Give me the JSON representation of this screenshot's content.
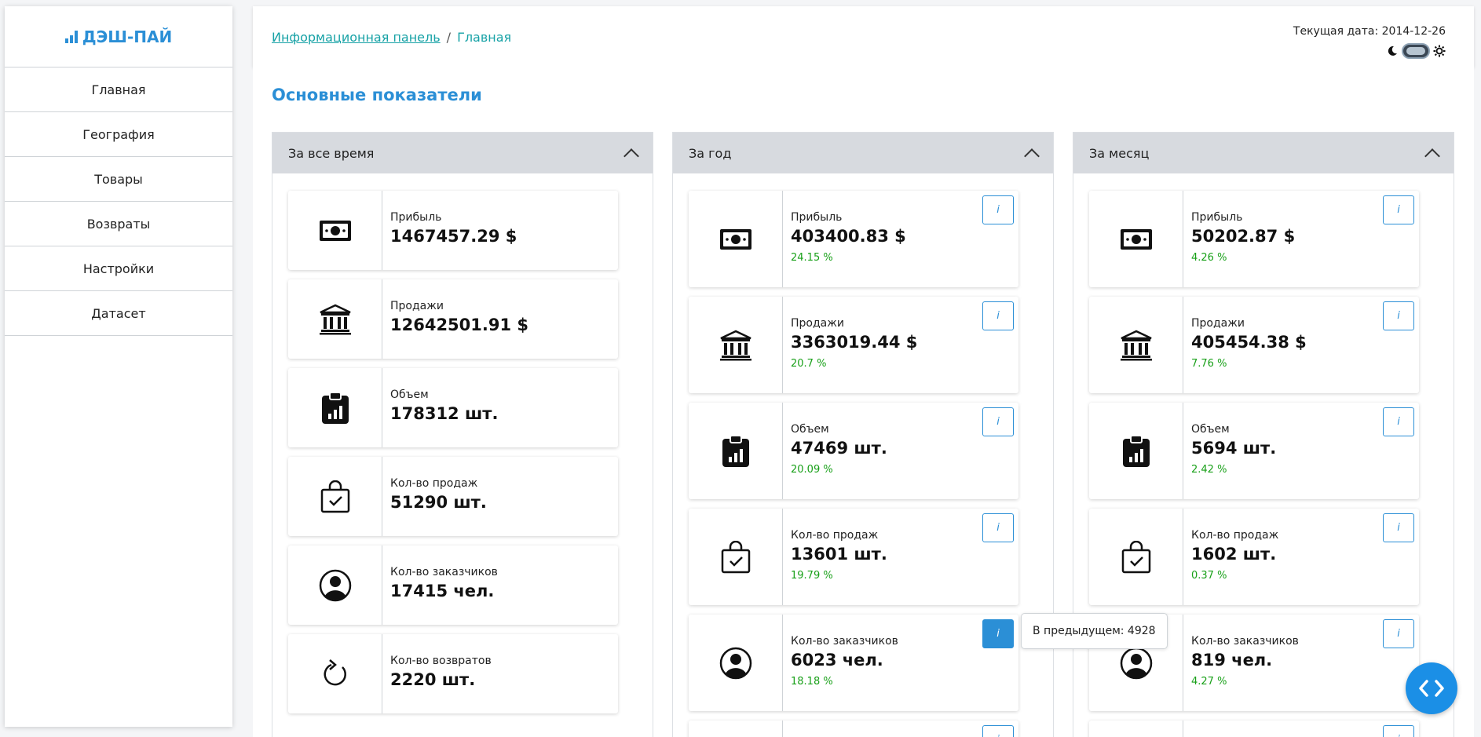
{
  "app": {
    "logo": "ДЭШ-ПАЙ"
  },
  "sidebar": {
    "items": [
      {
        "label": "Главная"
      },
      {
        "label": "География"
      },
      {
        "label": "Товары"
      },
      {
        "label": "Возвраты"
      },
      {
        "label": "Настройки"
      },
      {
        "label": "Датасет"
      }
    ]
  },
  "header": {
    "breadcrumb": {
      "link": "Информационная панель",
      "separator": "/",
      "current": "Главная"
    },
    "date": "Текущая дата: 2014-12-26"
  },
  "main": {
    "title": "Основные показатели"
  },
  "columns": [
    {
      "title": "За все время",
      "cards": [
        {
          "icon": "money-icon",
          "label": "Прибыль",
          "value": "1467457.29 $"
        },
        {
          "icon": "bank-icon",
          "label": "Продажи",
          "value": "12642501.91 $"
        },
        {
          "icon": "clipboard-chart-icon",
          "label": "Объем",
          "value": "178312 шт."
        },
        {
          "icon": "shopping-bag-check-icon",
          "label": "Кол-во продаж",
          "value": "51290 шт."
        },
        {
          "icon": "user-circle-icon",
          "label": "Кол-во заказчиков",
          "value": "17415 чел."
        },
        {
          "icon": "refresh-icon",
          "label": "Кол-во возвратов",
          "value": "2220 шт."
        }
      ]
    },
    {
      "title": "За год",
      "cards": [
        {
          "icon": "money-icon",
          "label": "Прибыль",
          "value": "403400.83 $",
          "pct": "24.15 %"
        },
        {
          "icon": "bank-icon",
          "label": "Продажи",
          "value": "3363019.44 $",
          "pct": "20.7 %"
        },
        {
          "icon": "clipboard-chart-icon",
          "label": "Объем",
          "value": "47469 шт.",
          "pct": "20.09 %"
        },
        {
          "icon": "shopping-bag-check-icon",
          "label": "Кол-во продаж",
          "value": "13601 шт.",
          "pct": "19.79 %"
        },
        {
          "icon": "user-circle-icon",
          "label": "Кол-во заказчиков",
          "value": "6023 чел.",
          "pct": "18.18 %"
        }
      ]
    },
    {
      "title": "За месяц",
      "cards": [
        {
          "icon": "money-icon",
          "label": "Прибыль",
          "value": "50202.87 $",
          "pct": "4.26 %"
        },
        {
          "icon": "bank-icon",
          "label": "Продажи",
          "value": "405454.38 $",
          "pct": "7.76 %"
        },
        {
          "icon": "clipboard-chart-icon",
          "label": "Объем",
          "value": "5694 шт.",
          "pct": "2.42 %"
        },
        {
          "icon": "shopping-bag-check-icon",
          "label": "Кол-во продаж",
          "value": "1602 шт.",
          "pct": "0.37 %"
        },
        {
          "icon": "user-circle-icon",
          "label": "Кол-во заказчиков",
          "value": "819 чел.",
          "pct": "4.27 %"
        }
      ]
    }
  ],
  "info_button": {
    "label": "i"
  },
  "tooltip": {
    "text": "В предыдущем: 4928"
  },
  "colors": {
    "accent": "#2b8fd6",
    "positive": "#18a018",
    "header_bg": "#d7dadf"
  }
}
